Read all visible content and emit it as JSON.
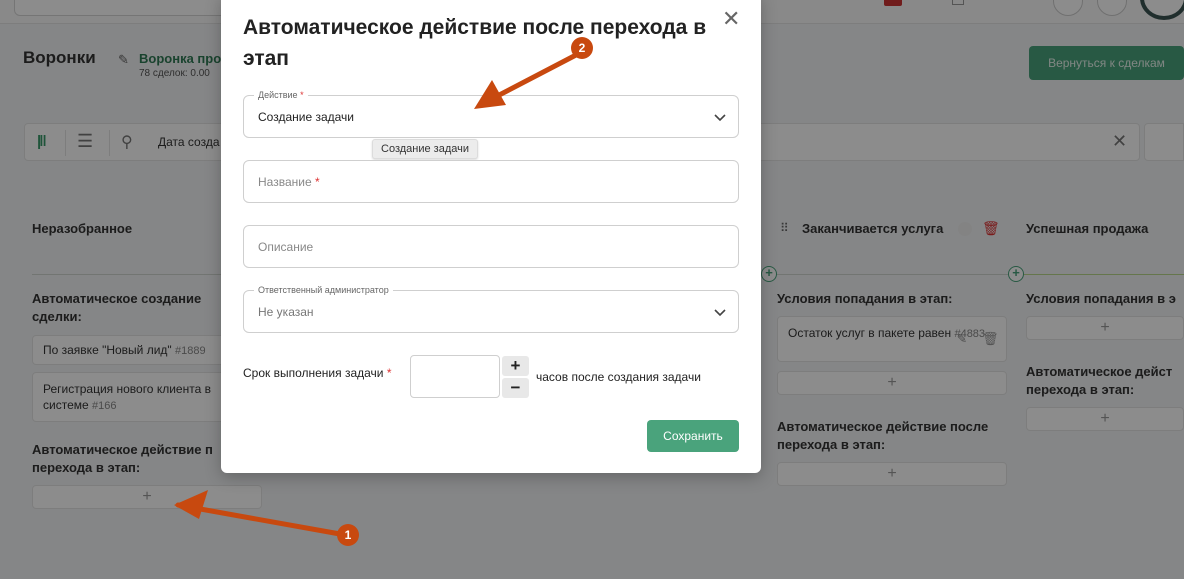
{
  "page": {
    "title": "Воронки",
    "funnel_name": "Воронка про",
    "deals_count": "78 сделок: 0.00",
    "back_button": "Вернуться к сделкам",
    "filter_text": "Дата созда"
  },
  "columns": {
    "unsorted": {
      "title": "Неразобранное",
      "auto_create_title": "Автоматическое создание сделки:",
      "cards": [
        {
          "text": "По заявке \"Новый лид\"",
          "num": "#1889"
        },
        {
          "text": "Регистрация нового клиента в системе",
          "num": "#166"
        }
      ],
      "auto_action_title": "Автоматическое действие п перехода в этап:"
    },
    "ending": {
      "title": "Заканчивается услуга",
      "conditions_title": "Условия попадания в этап:",
      "condition_card": {
        "text": "Остаток услуг в пакете равен",
        "num": "#4883"
      },
      "auto_action_title": "Автоматическое действие после перехода в этап:"
    },
    "success": {
      "title": "Успешная продажа",
      "conditions_title": "Условия попадания в э",
      "auto_action_title": "Автоматическое дейст перехода в этап:"
    }
  },
  "modal": {
    "title": "Автоматическое действие после перехода в этап",
    "action_field": {
      "label": "Действие",
      "value": "Создание задачи"
    },
    "tooltip": "Создание задачи",
    "name_field": {
      "placeholder": "Название"
    },
    "description_field": {
      "placeholder": "Описание"
    },
    "admin_field": {
      "label": "Ответственный администратор",
      "value": "Не указан"
    },
    "deadline": {
      "label": "Срок выполнения задачи",
      "suffix": "часов после создания задачи",
      "plus": "+",
      "minus": "−"
    },
    "save_button": "Сохранить"
  },
  "annotations": {
    "badge_1": "1",
    "badge_2": "2",
    "color": "#c8490f"
  },
  "colors": {
    "accent_green": "#4aa37c",
    "required_red": "#d33"
  }
}
